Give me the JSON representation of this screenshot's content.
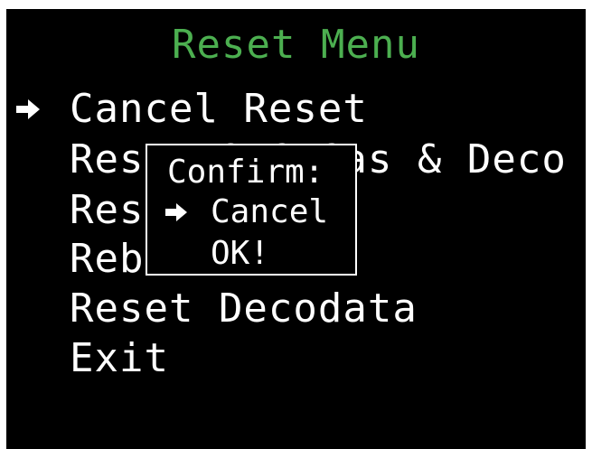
{
  "screen": {
    "title": "Reset Menu",
    "title_color": "#4caf50",
    "background_color": "#000000",
    "text_color": "#ffffff"
  },
  "menu": {
    "items": [
      {
        "label": "Cancel Reset",
        "selected": true
      },
      {
        "label": "Reset OEG Gas & Deco",
        "selected": false
      },
      {
        "label": "Reset Clock",
        "selected": false
      },
      {
        "label": "Reboot",
        "selected": false
      },
      {
        "label": "Reset Decodata",
        "selected": false
      },
      {
        "label": "Exit",
        "selected": false
      }
    ],
    "selector_icon": "arrow-right-icon"
  },
  "dialog": {
    "title": "Confirm:",
    "options": [
      {
        "label": "Cancel",
        "selected": true
      },
      {
        "label": "OK!",
        "selected": false
      }
    ],
    "selector_icon": "arrow-right-icon"
  }
}
